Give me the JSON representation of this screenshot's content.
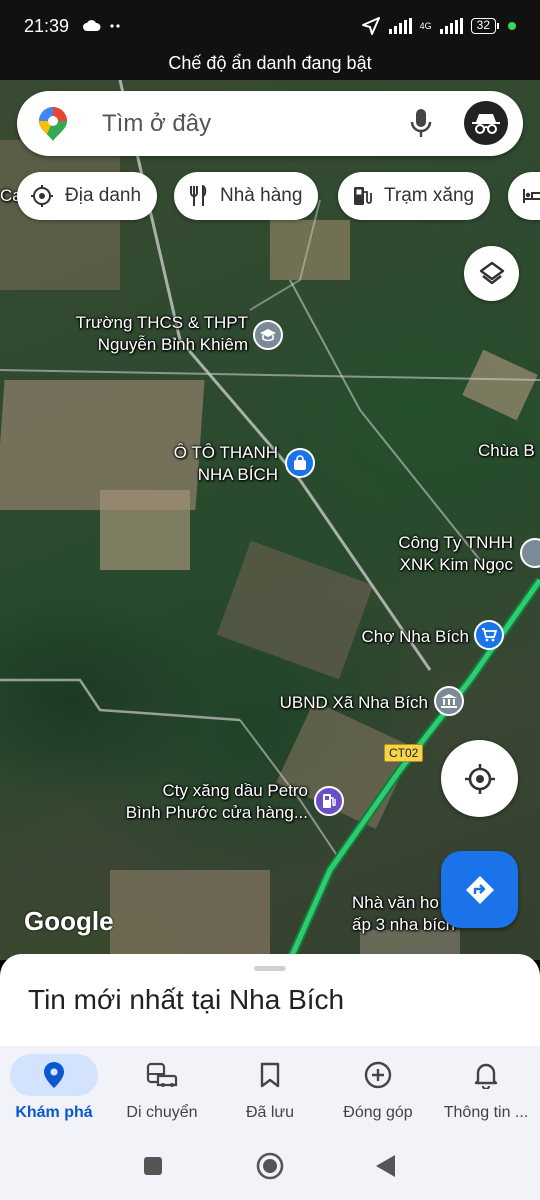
{
  "status_bar": {
    "time": "21:39",
    "left_icons": [
      "cloud-icon",
      "more-dots-icon"
    ],
    "network_type": "4G",
    "battery": "32",
    "right_icons": [
      "location-arrow-icon",
      "signal-icon",
      "signal-icon",
      "battery-icon",
      "dot-icon"
    ]
  },
  "banner": {
    "text": "Chế độ ẩn danh đang bật"
  },
  "search": {
    "placeholder": "Tìm ở đây",
    "icons": [
      "maps-pin-logo-icon",
      "microphone-icon",
      "incognito-icon"
    ]
  },
  "chips": [
    {
      "label": "Địa danh",
      "icon": "landmark-icon"
    },
    {
      "label": "Nhà hàng",
      "icon": "fork-knife-icon"
    },
    {
      "label": "Trạm xăng",
      "icon": "gas-pump-icon"
    },
    {
      "label": "",
      "icon": "hotel-bed-icon"
    }
  ],
  "map": {
    "labels": {
      "school_1": "Trường THCS & THPT",
      "school_2": "Nguyễn Bỉnh Khiêm",
      "car_1": "Ô TÔ THANH",
      "car_2": "NHA BÍCH",
      "temple": "Chùa B",
      "company_1": "Công Ty TNHH",
      "company_2": "XNK Kim Ngọc",
      "market": "Chợ Nha Bích",
      "ubnd": "UBND Xã Nha Bích",
      "gas_1": "Cty xăng dầu Petro",
      "gas_2": "Bình Phước cửa hàng...",
      "culture_1": "Nhà văn ho",
      "culture_2": "ấp 3 nha bích",
      "edge_left": "Ca",
      "road_shield": "CT02"
    },
    "brand": "Google",
    "colors": {
      "highway": "#2ecc71",
      "pin_blue": "#1a73e8",
      "pin_gray": "#7b8a97",
      "pin_purple": "#6a4fc8"
    }
  },
  "bottom_sheet": {
    "title": "Tin mới nhất tại Nha Bích"
  },
  "bottom_nav": [
    {
      "label": "Khám phá",
      "icon": "explore-pin-icon",
      "active": true
    },
    {
      "label": "Di chuyển",
      "icon": "commute-icon",
      "active": false
    },
    {
      "label": "Đã lưu",
      "icon": "bookmark-icon",
      "active": false
    },
    {
      "label": "Đóng góp",
      "icon": "add-circle-icon",
      "active": false
    },
    {
      "label": "Thông tin ...",
      "icon": "bell-icon",
      "active": false
    }
  ],
  "system_nav": [
    "recents-square-icon",
    "home-circle-icon",
    "back-triangle-icon"
  ]
}
